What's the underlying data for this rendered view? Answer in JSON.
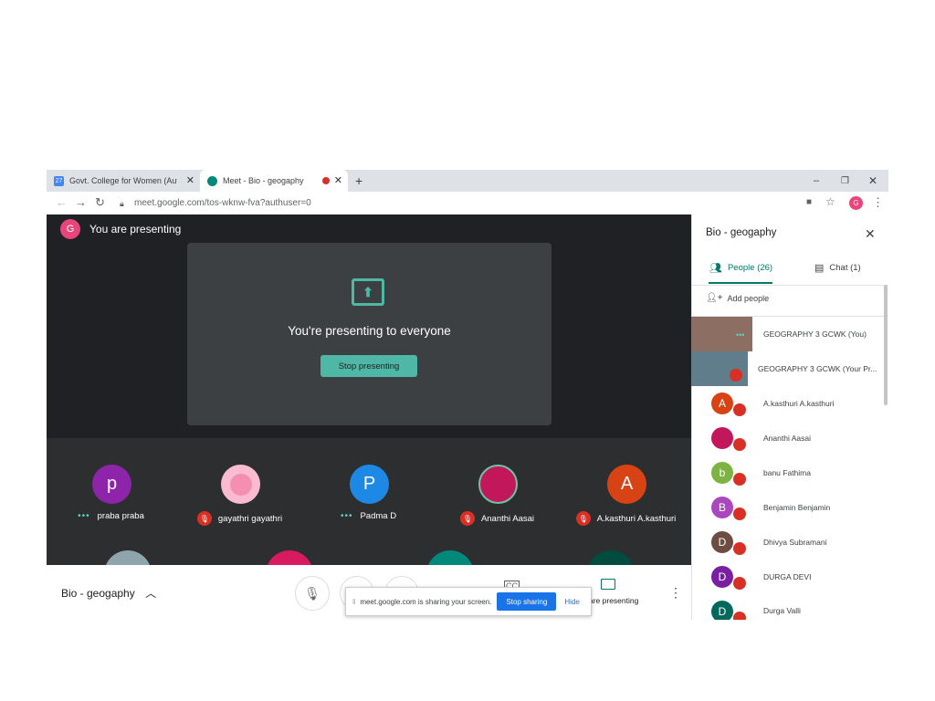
{
  "browser": {
    "tabs": [
      {
        "label": "Govt. College for Women (Autono",
        "icon": "calendar-icon",
        "badge": "27"
      },
      {
        "label": "Meet - Bio - geogaphy",
        "icon": "meet-icon"
      }
    ],
    "new_tab": "+",
    "url": "meet.google.com/tos-wknw-fva?authuser=0",
    "profile_initial": "G"
  },
  "presenting": {
    "header": "You are presenting",
    "avatar_initial": "G",
    "message": "You're presenting to everyone",
    "stop_label": "Stop presenting"
  },
  "participants_grid": [
    {
      "name": "praba praba",
      "initial": "p",
      "color": "#8e24aa",
      "status": "speaking"
    },
    {
      "name": "gayathri gayathri",
      "initial": "",
      "color": "#f8bbd0",
      "status": "muted"
    },
    {
      "name": "Padma D",
      "initial": "P",
      "color": "#1e88e5",
      "status": "speaking"
    },
    {
      "name": "Ananthi Aasai",
      "initial": "",
      "color": "#c2185b",
      "status": "muted"
    },
    {
      "name": "A.kasthuri A.kasthuri",
      "initial": "A",
      "color": "#d84315",
      "status": "muted"
    }
  ],
  "toolbar": {
    "meeting_title": "Bio - geogaphy",
    "presenting_label": "are presenting"
  },
  "share_bar": {
    "message": "meet.google.com is sharing your screen.",
    "stop_label": "Stop sharing",
    "hide_label": "Hide"
  },
  "panel": {
    "title": "Bio - geogaphy",
    "people_tab": "People (26)",
    "chat_tab": "Chat (1)",
    "add_people": "Add people",
    "people": [
      {
        "name": "GEOGRAPHY 3 GCWK (You)",
        "initial": "",
        "color": "#8d6e63"
      },
      {
        "name": "GEOGRAPHY 3 GCWK (Your Pr...",
        "initial": "",
        "color": "#607d8b"
      },
      {
        "name": "A.kasthuri A.kasthuri",
        "initial": "A",
        "color": "#d84315"
      },
      {
        "name": "Ananthi Aasai",
        "initial": "",
        "color": "#c2185b"
      },
      {
        "name": "banu Fathima",
        "initial": "b",
        "color": "#7cb342"
      },
      {
        "name": "Benjamin Benjamin",
        "initial": "B",
        "color": "#ab47bc"
      },
      {
        "name": "Dhivya Subramani",
        "initial": "D",
        "color": "#6d4c41"
      },
      {
        "name": "DURGA DEVI",
        "initial": "D",
        "color": "#7b1fa2"
      },
      {
        "name": "Durga Valli",
        "initial": "D",
        "color": "#00695c"
      }
    ]
  }
}
